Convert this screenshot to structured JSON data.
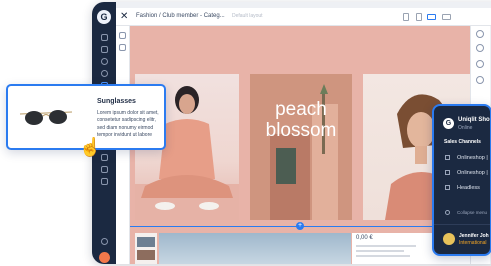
{
  "topbar": {
    "close_glyph": "✕",
    "path": "Fashion / Club member - Categ...",
    "path_sub": "Default layout",
    "devices": [
      "tablet-icon",
      "mobile-icon",
      "desktop-icon",
      "widescreen-icon"
    ]
  },
  "canvas": {
    "headline": "peach blossom",
    "add_glyph": "+",
    "product_price": "0,00 €"
  },
  "product_card": {
    "title": "Sunglasses",
    "description": "Lorem ipsum dolor sit amet, consetetur sadipscing elitr, sed diam nonumy eirmod tempor invidunt ut labore"
  },
  "cursor_glyph": "☝",
  "sales_panel": {
    "logo_glyph": "G",
    "shop_name": "Uniqlit Sho",
    "status": "Online",
    "section_title": "Sales Channels",
    "channels": [
      {
        "label": "Onlineshop |",
        "icon": "storefront-icon"
      },
      {
        "label": "Onlineshop |",
        "icon": "storefront-icon"
      },
      {
        "label": "Headless",
        "icon": "headless-icon"
      }
    ],
    "collapse_label": "Collapse menu",
    "user_name": "Jennifer Joh",
    "user_role": "International"
  },
  "rail_logo_glyph": "G",
  "colors": {
    "rail": "#1b2941",
    "accent": "#2b7bf0",
    "canvas_bg": "#e8b3a8",
    "warning": "#f5a623"
  }
}
